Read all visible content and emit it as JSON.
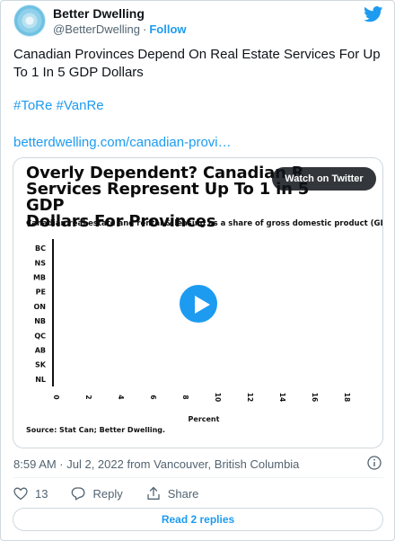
{
  "tweet": {
    "author": {
      "name": "Better Dwelling",
      "handle": "@BetterDwelling",
      "follow_label": "Follow"
    },
    "text": "Canadian Provinces Depend On Real Estate Services For Up To 1 In 5 GDP Dollars",
    "hashtags": [
      "#ToRe",
      "#VanRe"
    ],
    "link": "betterdwelling.com/canadian-provi…",
    "media": {
      "watch_label": "Watch on Twitter",
      "chart_title_line1": "Overly Dependent? Canadian R",
      "chart_title_line2": "Services Represent Up To 1 in 5 GDP",
      "chart_title_line3": "Dollars For Provinces",
      "chart_subtitle": "Canadian real estate and rental & leasing as a share of gross domestic product (GDP).",
      "source": "Source: Stat Can; Better Dwelling."
    },
    "timestamp": "8:59 AM · Jul 2, 2022 from Vancouver, British Columbia",
    "like_count": "13",
    "reply_label": "Reply",
    "share_label": "Share",
    "read_replies_label": "Read 2 replies",
    "colors": {
      "accent": "#1d9bf0",
      "muted": "#536471",
      "text": "#0f1419"
    },
    "icons": [
      "twitter-bird-icon",
      "play-icon",
      "info-icon",
      "heart-icon",
      "reply-icon",
      "share-icon"
    ]
  },
  "chart_data": {
    "type": "bar",
    "categories": [
      "BC",
      "NS",
      "MB",
      "PE",
      "ON",
      "NB",
      "QC",
      "AB",
      "SK",
      "NL"
    ],
    "series": [],
    "x_ticks": [
      "0",
      "2",
      "4",
      "6",
      "8",
      "10",
      "12",
      "14",
      "16",
      "18"
    ],
    "xlabel": "Percent",
    "xlim": [
      0,
      18
    ],
    "orientation": "horizontal"
  }
}
